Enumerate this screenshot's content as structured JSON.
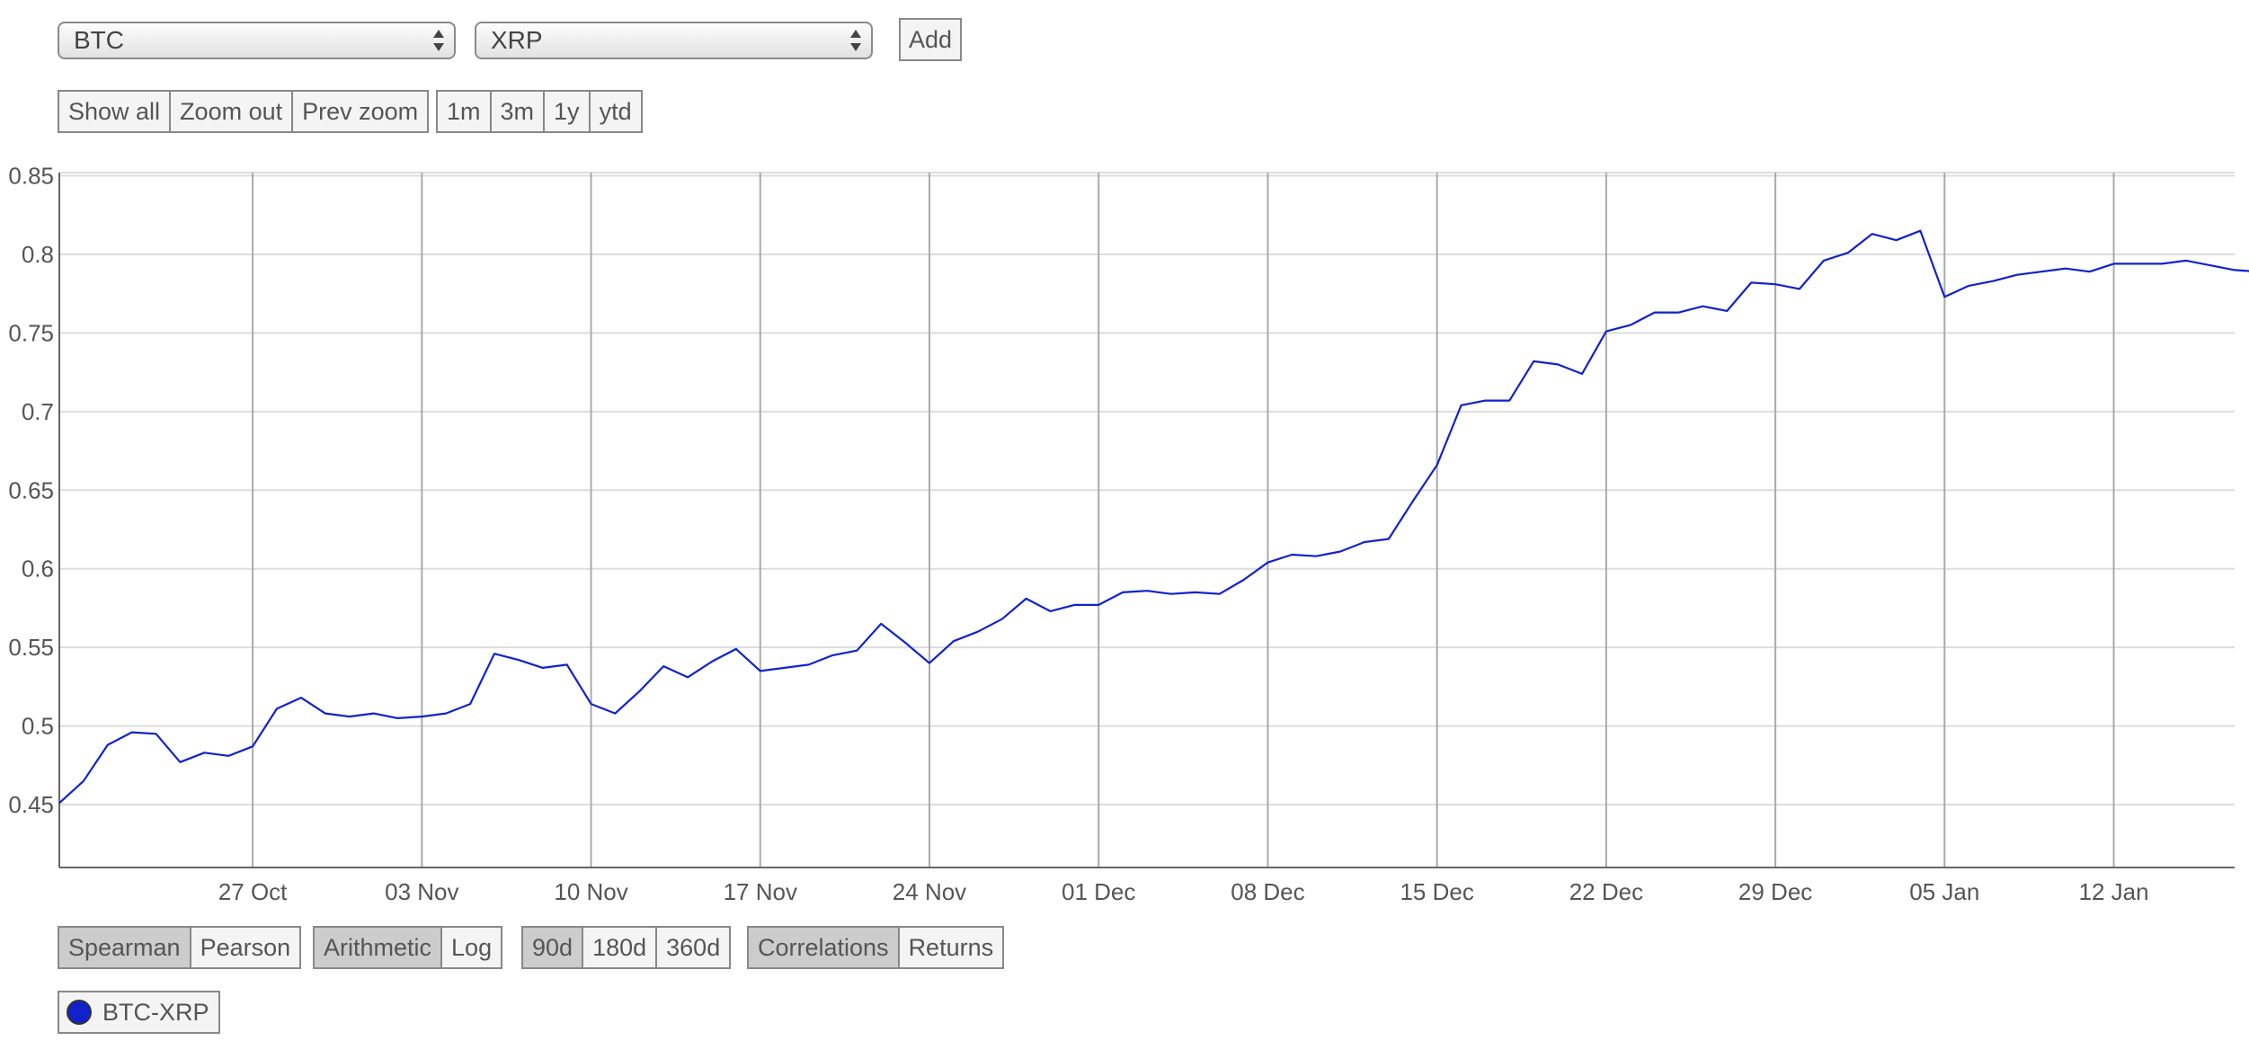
{
  "selectors": {
    "asset_a": "BTC",
    "asset_b": "XRP",
    "add_label": "Add"
  },
  "zoom_controls": {
    "buttons": [
      "Show all",
      "Zoom out",
      "Prev zoom"
    ],
    "ranges": [
      "1m",
      "3m",
      "1y",
      "ytd"
    ]
  },
  "options": {
    "method": {
      "items": [
        "Spearman",
        "Pearson"
      ],
      "active": "Spearman"
    },
    "scale": {
      "items": [
        "Arithmetic",
        "Log"
      ],
      "active": "Arithmetic"
    },
    "window": {
      "items": [
        "90d",
        "180d",
        "360d"
      ],
      "active": "90d"
    },
    "mode": {
      "items": [
        "Correlations",
        "Returns"
      ],
      "active": "Correlations"
    }
  },
  "legend": {
    "label": "BTC-XRP",
    "color": "#1122cc"
  },
  "colors": {
    "line": "#1122cc",
    "grid": "#dddddd",
    "vgrid": "#aaaaaa",
    "axis": "#666666",
    "active_button": "#cccccc"
  },
  "chart_data": {
    "type": "line",
    "x_start": "2018-10-19",
    "x_end": "2019-01-17",
    "ylim": [
      0.41,
      0.852
    ],
    "yticks": [
      0.45,
      0.5,
      0.55,
      0.6,
      0.65,
      0.7,
      0.75,
      0.8,
      0.85
    ],
    "xticks": [
      {
        "date": "2018-10-27",
        "label": "27 Oct"
      },
      {
        "date": "2018-11-03",
        "label": "03 Nov"
      },
      {
        "date": "2018-11-10",
        "label": "10 Nov"
      },
      {
        "date": "2018-11-17",
        "label": "17 Nov"
      },
      {
        "date": "2018-11-24",
        "label": "24 Nov"
      },
      {
        "date": "2018-12-01",
        "label": "01 Dec"
      },
      {
        "date": "2018-12-08",
        "label": "08 Dec"
      },
      {
        "date": "2018-12-15",
        "label": "15 Dec"
      },
      {
        "date": "2018-12-22",
        "label": "22 Dec"
      },
      {
        "date": "2018-12-29",
        "label": "29 Dec"
      },
      {
        "date": "2019-01-05",
        "label": "05 Jan"
      },
      {
        "date": "2019-01-12",
        "label": "12 Jan"
      }
    ],
    "grid": true,
    "series": [
      {
        "name": "BTC-XRP",
        "x": [
          "2018-10-19",
          "2018-10-20",
          "2018-10-21",
          "2018-10-22",
          "2018-10-23",
          "2018-10-24",
          "2018-10-25",
          "2018-10-26",
          "2018-10-27",
          "2018-10-28",
          "2018-10-29",
          "2018-10-30",
          "2018-10-31",
          "2018-11-01",
          "2018-11-02",
          "2018-11-03",
          "2018-11-04",
          "2018-11-05",
          "2018-11-06",
          "2018-11-07",
          "2018-11-08",
          "2018-11-09",
          "2018-11-10",
          "2018-11-11",
          "2018-11-12",
          "2018-11-13",
          "2018-11-14",
          "2018-11-15",
          "2018-11-16",
          "2018-11-17",
          "2018-11-18",
          "2018-11-19",
          "2018-11-20",
          "2018-11-21",
          "2018-11-22",
          "2018-11-23",
          "2018-11-24",
          "2018-11-25",
          "2018-11-26",
          "2018-11-27",
          "2018-11-28",
          "2018-11-29",
          "2018-11-30",
          "2018-12-01",
          "2018-12-02",
          "2018-12-03",
          "2018-12-04",
          "2018-12-05",
          "2018-12-06",
          "2018-12-07",
          "2018-12-08",
          "2018-12-09",
          "2018-12-10",
          "2018-12-11",
          "2018-12-12",
          "2018-12-13",
          "2018-12-14",
          "2018-12-15",
          "2018-12-16",
          "2018-12-17",
          "2018-12-18",
          "2018-12-19",
          "2018-12-20",
          "2018-12-21",
          "2018-12-22",
          "2018-12-23",
          "2018-12-24",
          "2018-12-25",
          "2018-12-26",
          "2018-12-27",
          "2018-12-28",
          "2018-12-29",
          "2018-12-30",
          "2018-12-31",
          "2019-01-01",
          "2019-01-02",
          "2019-01-03",
          "2019-01-04",
          "2019-01-05",
          "2019-01-06",
          "2019-01-07",
          "2019-01-08",
          "2019-01-09",
          "2019-01-10",
          "2019-01-11",
          "2019-01-12",
          "2019-01-13",
          "2019-01-14",
          "2019-01-15",
          "2019-01-16",
          "2019-01-17",
          "2019-01-18"
        ],
        "y": [
          0.451,
          0.465,
          0.488,
          0.496,
          0.495,
          0.477,
          0.483,
          0.481,
          0.487,
          0.511,
          0.518,
          0.508,
          0.506,
          0.508,
          0.505,
          0.506,
          0.508,
          0.514,
          0.546,
          0.542,
          0.537,
          0.539,
          0.514,
          0.508,
          0.522,
          0.538,
          0.531,
          0.541,
          0.549,
          0.535,
          0.537,
          0.539,
          0.545,
          0.548,
          0.565,
          0.553,
          0.54,
          0.554,
          0.56,
          0.568,
          0.581,
          0.573,
          0.577,
          0.577,
          0.585,
          0.586,
          0.584,
          0.585,
          0.584,
          0.593,
          0.604,
          0.609,
          0.608,
          0.611,
          0.617,
          0.619,
          0.643,
          0.666,
          0.704,
          0.707,
          0.707,
          0.732,
          0.73,
          0.724,
          0.751,
          0.755,
          0.763,
          0.763,
          0.767,
          0.764,
          0.782,
          0.781,
          0.778,
          0.796,
          0.801,
          0.813,
          0.809,
          0.815,
          0.773,
          0.78,
          0.783,
          0.787,
          0.789,
          0.791,
          0.789,
          0.794,
          0.794,
          0.794,
          0.796,
          0.793,
          0.79,
          0.789
        ]
      }
    ]
  }
}
